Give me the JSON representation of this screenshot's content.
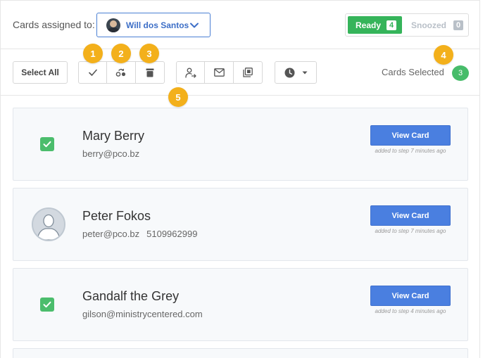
{
  "header": {
    "assigned_label": "Cards assigned to:",
    "assignee_name": "Will dos Santos",
    "ready_label": "Ready",
    "ready_count": "4",
    "snoozed_label": "Snoozed",
    "snoozed_count": "0"
  },
  "toolbar": {
    "select_all": "Select All",
    "cards_selected_label": "Cards Selected",
    "cards_selected_count": "3",
    "group1": [
      "check-icon",
      "step-icon",
      "trash-icon"
    ],
    "group2": [
      "reassign-icon",
      "email-icon",
      "bulk-copy-icon"
    ],
    "clock": "clock-icon"
  },
  "callouts": [
    "1",
    "2",
    "3",
    "4",
    "5"
  ],
  "cards": [
    {
      "name": "Mary Berry",
      "email": "berry@pco.bz",
      "phone": "",
      "selected": true,
      "view_label": "View Card",
      "added": "added to step 7 minutes ago"
    },
    {
      "name": "Peter Fokos",
      "email": "peter@pco.bz",
      "phone": "5109962999",
      "selected": false,
      "view_label": "View Card",
      "added": "added to step 7 minutes ago"
    },
    {
      "name": "Gandalf the Grey",
      "email": "gilson@ministrycentered.com",
      "phone": "",
      "selected": true,
      "view_label": "View Card",
      "added": "added to step 4 minutes ago"
    }
  ],
  "colors": {
    "accent_blue": "#4a7fe0",
    "ready_green": "#35b45a",
    "callout_orange": "#f3b01b",
    "check_green": "#4bbd6c"
  }
}
